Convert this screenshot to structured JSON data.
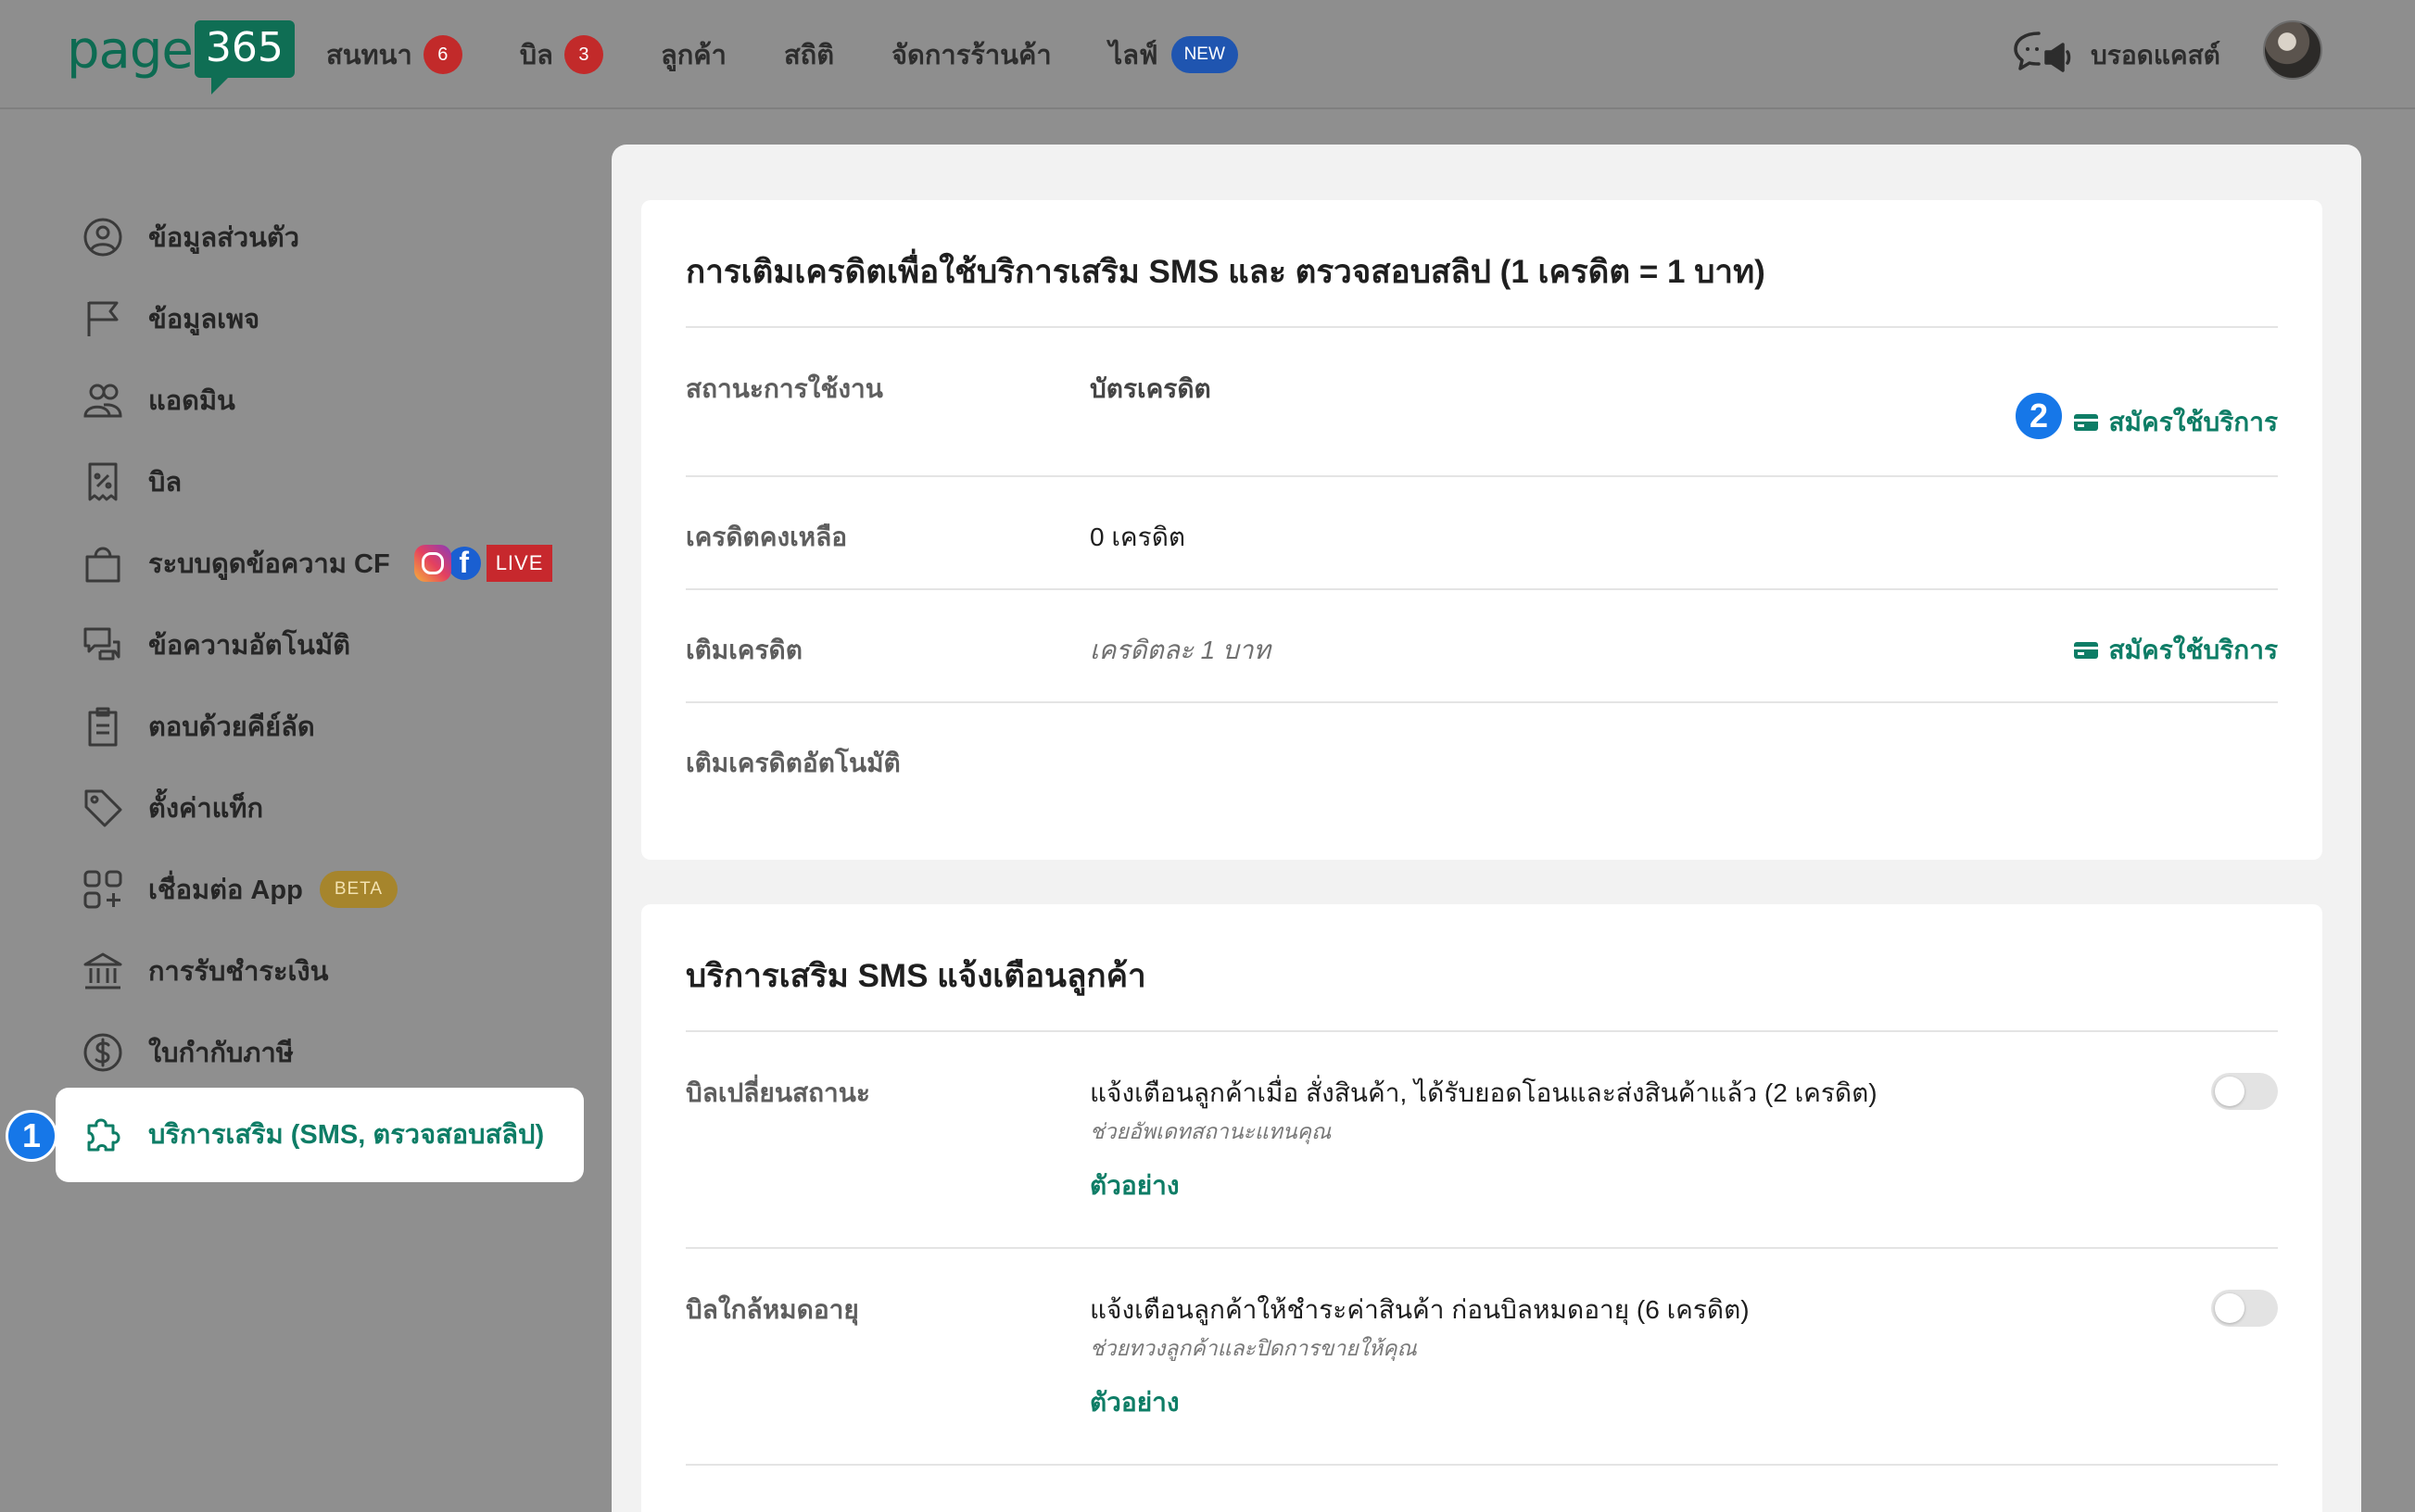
{
  "colors": {
    "accent": "#0e7d66",
    "badge_red": "#c22a2a",
    "badge_blue": "#1f55b0",
    "step_blue": "#1677e8"
  },
  "header": {
    "logo_text": "page",
    "logo_number": "365",
    "nav": [
      {
        "label": "สนทนา",
        "badge": "6"
      },
      {
        "label": "บิล",
        "badge": "3"
      },
      {
        "label": "ลูกค้า"
      },
      {
        "label": "สถิติ"
      },
      {
        "label": "จัดการร้านค้า"
      },
      {
        "label": "ไลฟ์",
        "tag": "NEW"
      }
    ],
    "broadcast_label": "บรอดแคสต์",
    "broadcast_icon": "megaphone-chat-icon",
    "avatar": "user-avatar"
  },
  "sidebar": {
    "items": [
      {
        "label": "ข้อมูลส่วนตัว",
        "icon": "user-circle-icon"
      },
      {
        "label": "ข้อมูลเพจ",
        "icon": "flag-icon"
      },
      {
        "label": "แอดมิน",
        "icon": "users-icon"
      },
      {
        "label": "บิล",
        "icon": "receipt-icon"
      },
      {
        "label": "ระบบดูดข้อความ CF",
        "icon": "shopping-bag-icon",
        "live_tag": "LIVE"
      },
      {
        "label": "ข้อความอัตโนมัติ",
        "icon": "chat-bubbles-icon"
      },
      {
        "label": "ตอบด้วยคีย์ลัด",
        "icon": "clipboard-icon"
      },
      {
        "label": "ตั้งค่าแท็ก",
        "icon": "tag-icon"
      },
      {
        "label": "เชื่อมต่อ App",
        "icon": "apps-plus-icon",
        "beta_tag": "BETA"
      },
      {
        "label": "การรับชำระเงิน",
        "icon": "bank-icon"
      },
      {
        "label": "ใบกำกับภาษี",
        "icon": "dollar-circle-icon"
      }
    ],
    "active": {
      "label": "บริการเสริม (SMS, ตรวจสอบสลิป)",
      "icon": "puzzle-icon"
    },
    "step_badge": "1"
  },
  "credit_card": {
    "title": "การเติมเครดิตเพื่อใช้บริการเสริม SMS และ ตรวจสอบสลิป (1 เครดิต = 1 บาท)",
    "status_label": "สถานะการใช้งาน",
    "status_value": "บัตรเครดิต",
    "subscribe_label": "สมัครใช้บริการ",
    "step_badge": "2",
    "balance_label": "เครดิตคงเหลือ",
    "balance_value": "0 เครดิต",
    "topup_label": "เติมเครดิต",
    "topup_value": "เครดิตละ 1 บาท",
    "topup_action": "สมัครใช้บริการ",
    "auto_topup_label": "เติมเครดิตอัตโนมัติ"
  },
  "sms_card": {
    "title": "บริการเสริม SMS แจ้งเตือนลูกค้า",
    "rows": [
      {
        "label": "บิลเปลี่ยนสถานะ",
        "value": "แจ้งเตือนลูกค้าเมื่อ สั่งสินค้า, ได้รับยอดโอนและส่งสินค้าแล้ว (2 เครดิต)",
        "sub": "ช่วยอัพเดทสถานะแทนคุณ",
        "link": "ตัวอย่าง",
        "enabled": false
      },
      {
        "label": "บิลใกล้หมดอายุ",
        "value": "แจ้งเตือนลูกค้าให้ชำระค่าสินค้า ก่อนบิลหมดอายุ (6 เครดิต)",
        "sub": "ช่วยทวงลูกค้าและปิดการขายให้คุณ",
        "link": "ตัวอย่าง",
        "enabled": false
      }
    ]
  }
}
